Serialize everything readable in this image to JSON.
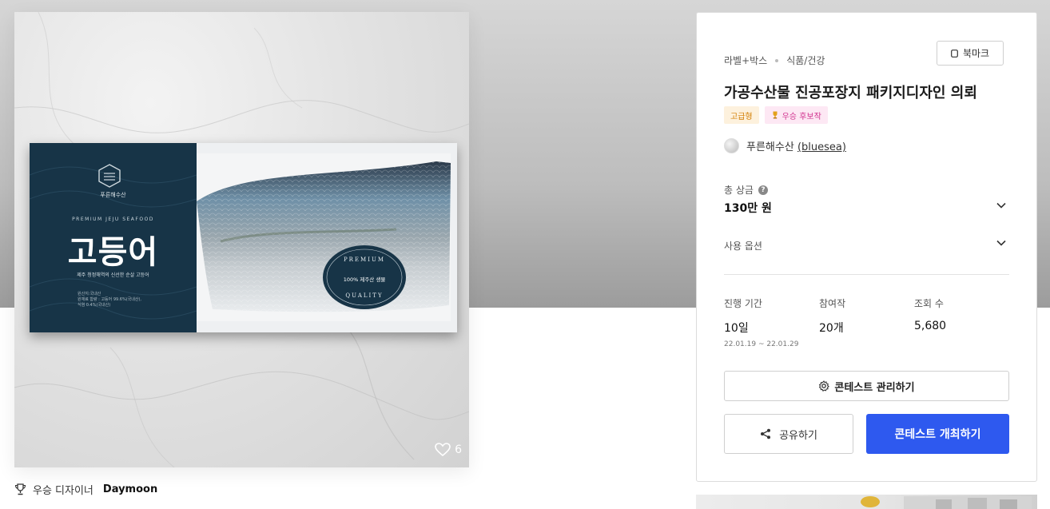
{
  "product": {
    "package_brand": "푸른해수산",
    "package_english": "PREMIUM JEJU SEAFOOD",
    "package_title": "고등어",
    "package_subtitle": "제주 청정해역의 신선한 순살 고등어",
    "package_info_1": "원산지:국내산",
    "package_info_2": "원재료 함량 : 고등어 99.6%(국내산),",
    "package_info_3": "식염 0.4%(국내산)",
    "seal_top": "PREMIUM",
    "seal_center": "100% 제주산 생물",
    "seal_bottom": "QUALITY",
    "likes": "6"
  },
  "designer": {
    "prefix": "우승 디자이너",
    "name": "Daymoon"
  },
  "panel": {
    "category_1": "라벨+박스",
    "category_2": "식품/건강",
    "bookmark_label": "북마크",
    "title": "가공수산물 진공포장지 패키지디자인 의뢰",
    "badge_grade": "고급형",
    "badge_winner": "우승 후보작",
    "host_name": "푸른해수산",
    "host_id": "(bluesea)",
    "prize_label": "총 상금",
    "prize_value": "130만 원",
    "option_label": "사용 옵션",
    "stats": {
      "period_label": "진행 기간",
      "period_value": "10일",
      "period_range": "22.01.19 ~ 22.01.29",
      "entries_label": "참여작",
      "entries_value": "20개",
      "views_label": "조회 수",
      "views_value": "5,680"
    },
    "manage_label": "콘테스트 관리하기",
    "share_label": "공유하기",
    "host_label": "콘테스트 개최하기"
  },
  "colors": {
    "primary": "#2e59ef",
    "package_navy": "#173447",
    "badge_orange": "#d27d00",
    "badge_pink": "#d1328f"
  }
}
